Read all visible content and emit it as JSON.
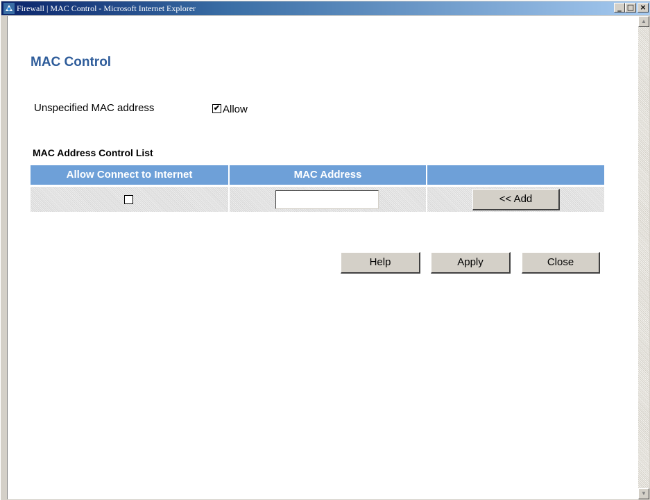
{
  "window": {
    "title": "Firewall | MAC Control - Microsoft Internet Explorer",
    "minimize_glyph": "_",
    "maximize_glyph": "□",
    "close_glyph": "×",
    "icon": "ie-icon"
  },
  "page": {
    "title": "MAC Control",
    "unspecified_label": "Unspecified MAC address",
    "allow_checked": true,
    "allow_check_glyph": "✔",
    "allow_label": "Allow"
  },
  "list": {
    "title": "MAC Address Control List",
    "columns": [
      "Allow Connect to Internet",
      "MAC Address",
      ""
    ],
    "row": {
      "allow_checked": false,
      "mac_value": "",
      "add_label": "<< Add"
    }
  },
  "buttons": {
    "help": "Help",
    "apply": "Apply",
    "close": "Close"
  },
  "colors": {
    "title_color": "#2e5c9a",
    "header_bg": "#6ea0d8",
    "titlebar_start": "#0a246a"
  }
}
